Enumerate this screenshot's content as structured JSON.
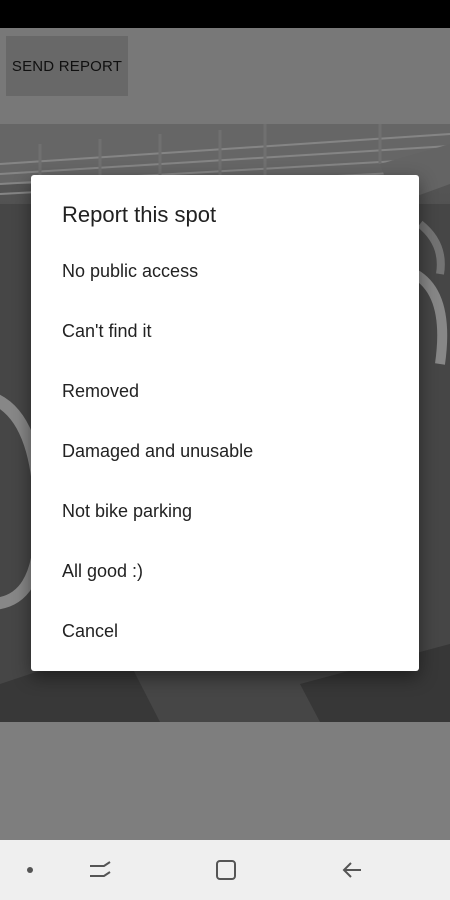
{
  "toolbar": {
    "send_report_label": "SEND REPORT"
  },
  "dialog": {
    "title": "Report this spot",
    "options": [
      {
        "label": "No public access"
      },
      {
        "label": "Can't find it"
      },
      {
        "label": "Removed"
      },
      {
        "label": "Damaged and unusable"
      },
      {
        "label": "Not bike parking"
      },
      {
        "label": "All good :)"
      },
      {
        "label": "Cancel"
      }
    ]
  },
  "navigation": {
    "icons": [
      "dot-icon",
      "recent-apps-icon",
      "home-icon",
      "back-icon"
    ]
  },
  "colors": {
    "dialog_background": "#ffffff",
    "dialog_text": "#212121",
    "status_bar": "#000000",
    "nav_bar": "#efefef"
  }
}
